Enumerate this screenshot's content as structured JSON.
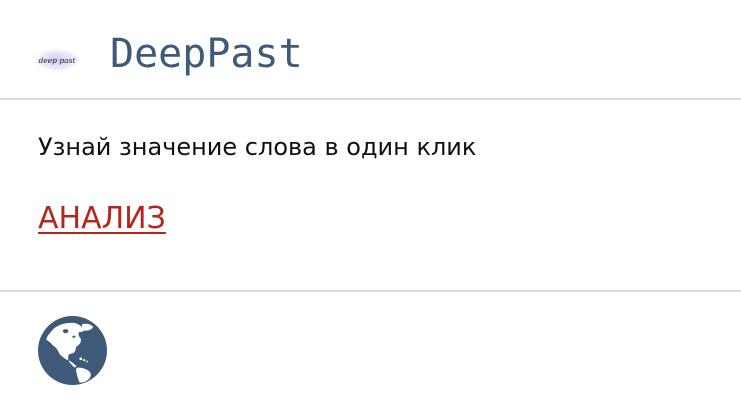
{
  "header": {
    "brand_name": "DeepPast",
    "logo_text": "deep past",
    "brand_color": "#3e5a78"
  },
  "main": {
    "tagline": "Узнай значение слова в один клик",
    "cta_label": "АНАЛИЗ",
    "cta_color": "#b3261e"
  },
  "footer": {
    "globe_icon": "globe-americas-icon",
    "globe_color": "#3e5a78"
  }
}
